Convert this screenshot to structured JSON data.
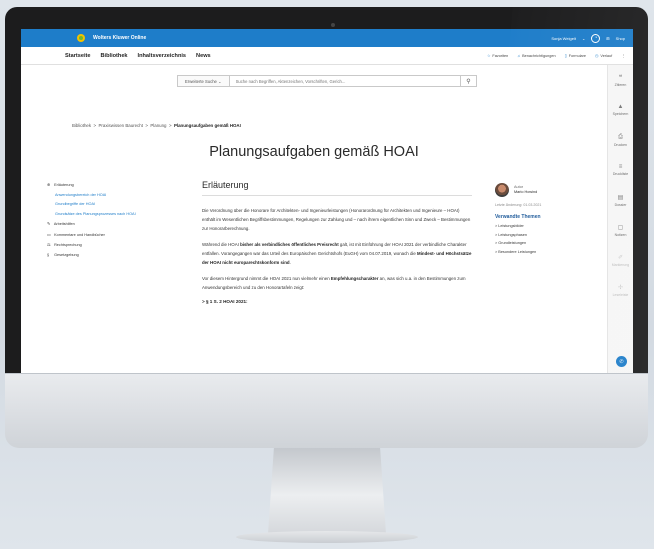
{
  "topbar": {
    "brand": "Wolters Kluwer Online",
    "user": "Sonja Weigelt",
    "shop": "Shop"
  },
  "nav": {
    "items": [
      "Startseite",
      "Bibliothek",
      "Inhaltsverzeichnis",
      "News"
    ],
    "favoriten": "Favoriten",
    "benachrichtigungen": "Benachrichtigungen",
    "formulare": "Formulare",
    "verlauf": "Verlauf"
  },
  "search": {
    "advanced": "Erweiterte Suche",
    "placeholder": "Suche nach Begriffen, Aktenzeichen, Vorschriften, Gerich..."
  },
  "breadcrumb": {
    "items": [
      "Bibliothek",
      "Praxiswissen Baurecht",
      "Planung"
    ],
    "current": "Planungsaufgaben gemäß HOAI"
  },
  "page_title": "Planungsaufgaben gemäß HOAI",
  "toc": {
    "erlaeuterung": "Erläuterung",
    "sub": [
      "Anwendungsbereich der HOAI",
      "Grundbegriffe der HOAI",
      "Grundsätze des Planungsprozesses nach HOAI"
    ],
    "arbeitshilfen": "Arbeitshilfen",
    "kommentare": "Kommentare und Handbücher",
    "rechtsprechung": "Rechtsprechung",
    "gesetzgebung": "Gesetzgebung"
  },
  "content": {
    "heading": "Erläuterung",
    "p1": "Die Verordnung über die Honorare für Architekten- und Ingenieurleistungen (Honorarordnung für Architekten und Ingenieure – HOAI) enthält im Wesentlichen Begriffsbestimmungen, Regelungen zur Zahlung und – nach ihrem eigentlichen Sinn und Zweck – Bestimmungen zur Honorarberechnung.",
    "p2_a": "Während die HOAI ",
    "p2_b": "bisher als verbindliches öffentliches Preisrecht",
    "p2_c": " galt, ist mit Einführung der HOAI 2021 der verbindliche Charakter entfallen. Vorangegangen war das Urteil des Europäischen Gerichtshofs (EuGH) vom 04.07.2019, wonach die ",
    "p2_d": "Mindest- und Höchstsätze der HOAI nicht europarechtskonform sind",
    "p2_e": ".",
    "p3_a": "Vor diesem Hintergrund nimmt die HOAI 2021 nun vielmehr einen ",
    "p3_b": "Empfehlungscharakter",
    "p3_c": " an, was sich u.a. in den Bestimmungen zum Anwendungsbereich und zu den Honorartafeln zeigt:",
    "section": "§ 1 S. 2 HOAI 2021:"
  },
  "aside": {
    "author_label": "Autor",
    "author_name": "Mario Howind",
    "changed": "Letzte Änderung: 01.03.2021",
    "related_title": "Verwandte Themen",
    "related": [
      "Leistungsbilder",
      "Leistungsphasen",
      "Grundleistungen",
      "Besondere Leistungen"
    ]
  },
  "rail": {
    "items": [
      "Zitieren",
      "Speichern",
      "Drucken",
      "Druckliste",
      "Dossier",
      "Notizen",
      "Markierung",
      "Leseleiste"
    ]
  }
}
